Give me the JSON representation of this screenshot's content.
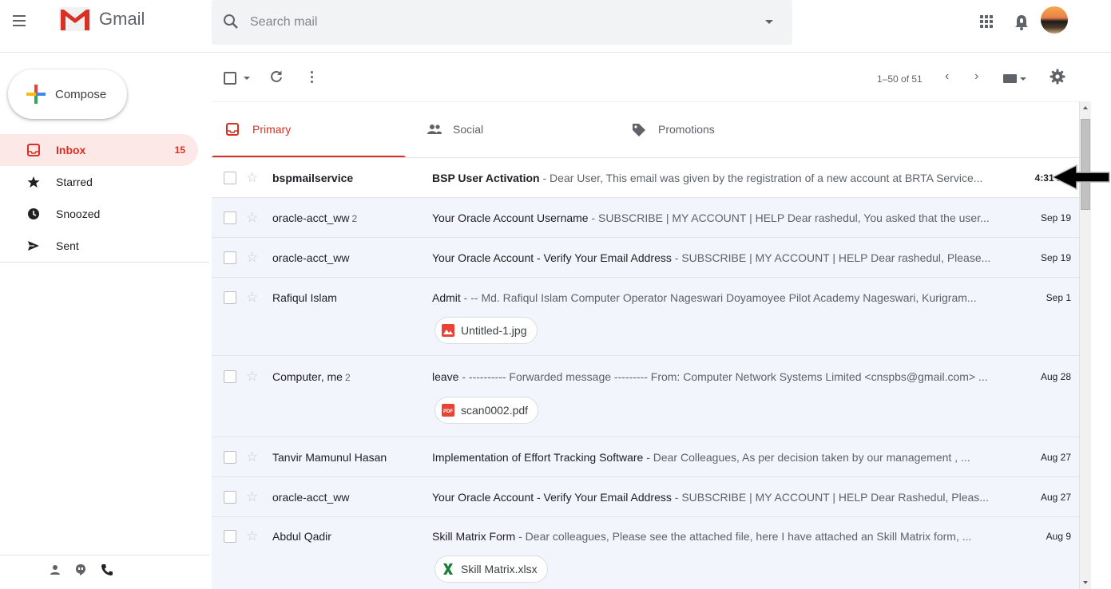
{
  "app": {
    "name": "Gmail"
  },
  "search": {
    "placeholder": "Search mail"
  },
  "compose": {
    "label": "Compose"
  },
  "nav": [
    {
      "label": "Inbox",
      "count": "15",
      "icon": "inbox-icon",
      "active": true
    },
    {
      "label": "Starred",
      "count": "",
      "icon": "star-icon"
    },
    {
      "label": "Snoozed",
      "count": "",
      "icon": "clock-icon"
    },
    {
      "label": "Sent",
      "count": "",
      "icon": "send-icon"
    }
  ],
  "toolbar": {
    "pagination": "1–50 of 51"
  },
  "tabs": [
    {
      "label": "Primary",
      "icon": "inbox-icon",
      "active": true
    },
    {
      "label": "Social",
      "icon": "people-icon"
    },
    {
      "label": "Promotions",
      "icon": "tag-icon"
    }
  ],
  "messages": [
    {
      "sender": "bspmailservice",
      "count": "",
      "subject": "BSP User Activation",
      "snippet": " - Dear User, This email was given by the registration of a new account at BRTA Service...",
      "date": "4:31 PM",
      "unread": true
    },
    {
      "sender": "oracle-acct_ww",
      "count": "2",
      "subject": "Your Oracle Account Username",
      "snippet": " - SUBSCRIBE | MY ACCOUNT | HELP Dear rashedul, You asked that the user...",
      "date": "Sep 19"
    },
    {
      "sender": "oracle-acct_ww",
      "count": "",
      "subject": "Your Oracle Account - Verify Your Email Address",
      "snippet": " - SUBSCRIBE | MY ACCOUNT | HELP Dear rashedul, Please...",
      "date": "Sep 19"
    },
    {
      "sender": "Rafiqul Islam",
      "count": "",
      "subject": "Admit",
      "snippet": " - -- Md. Rafiqul Islam Computer Operator Nageswari Doyamoyee Pilot Academy Nageswari, Kurigram...",
      "date": "Sep 1",
      "attachment": {
        "name": "Untitled-1.jpg",
        "icon": "image-file-icon"
      }
    },
    {
      "sender": "Computer, me",
      "count": "2",
      "subject": "leave",
      "snippet": " - ---------- Forwarded message --------- From: Computer Network Systems Limited <cnspbs@gmail.com> ...",
      "date": "Aug 28",
      "attachment": {
        "name": "scan0002.pdf",
        "icon": "pdf-file-icon"
      }
    },
    {
      "sender": "Tanvir Mamunul Hasan",
      "count": "",
      "subject": "Implementation of Effort Tracking Software",
      "snippet": " - Dear Colleagues, As per decision taken by our management , ...",
      "date": "Aug 27"
    },
    {
      "sender": "oracle-acct_ww",
      "count": "",
      "subject": "Your Oracle Account - Verify Your Email Address",
      "snippet": " - SUBSCRIBE | MY ACCOUNT | HELP Dear Rashedul, Pleas...",
      "date": "Aug 27"
    },
    {
      "sender": "Abdul Qadir",
      "count": "",
      "subject": "Skill Matrix Form",
      "snippet": " - Dear colleagues, Please see the attached file, here I have attached an Skill Matrix form, ...",
      "date": "Aug 9",
      "attachment": {
        "name": "Skill Matrix.xlsx",
        "icon": "excel-file-icon"
      }
    }
  ],
  "colors": {
    "accent": "#d93025",
    "read_row": "#f2f6fc",
    "active_nav": "#fce8e6"
  }
}
